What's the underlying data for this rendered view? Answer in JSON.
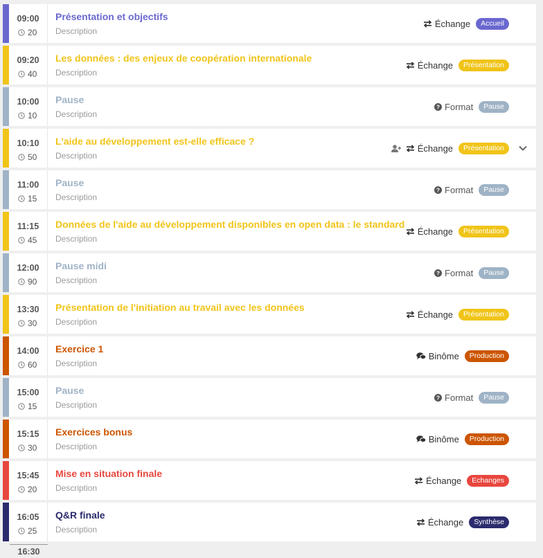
{
  "agenda": {
    "end_time": "16:30",
    "items": [
      {
        "time": "09:00",
        "duration": "20",
        "title": "Présentation et objectifs",
        "description": "Description",
        "exchange": "Échange",
        "exchange_icon": "arrows-exchange-icon",
        "badge": "Accueil",
        "color": "#6a68cf",
        "badge_color": "#6a68cf"
      },
      {
        "time": "09:20",
        "duration": "40",
        "title": "Les données : des enjeux de coopération internationale",
        "description": "Description",
        "exchange": "Échange",
        "exchange_icon": "arrows-exchange-icon",
        "badge": "Présentation",
        "color": "#f0c419",
        "badge_color": "#f0c419"
      },
      {
        "time": "10:00",
        "duration": "10",
        "title": "Pause",
        "description": "Description",
        "exchange": "Format",
        "exchange_icon": "question-circle-icon",
        "badge": "Pause",
        "color": "#9fb3c6",
        "badge_color": "#9fb3c6"
      },
      {
        "time": "10:10",
        "duration": "50",
        "title": "L'aide au développement est-elle efficace ?",
        "description": "Description",
        "exchange": "Échange",
        "exchange_icon": "arrows-exchange-icon",
        "badge": "Présentation",
        "color": "#f0c419",
        "badge_color": "#f0c419",
        "has_person_icon": true,
        "has_chevron": true
      },
      {
        "time": "11:00",
        "duration": "15",
        "title": "Pause",
        "description": "Description",
        "exchange": "Format",
        "exchange_icon": "question-circle-icon",
        "badge": "Pause",
        "color": "#9fb3c6",
        "badge_color": "#9fb3c6"
      },
      {
        "time": "11:15",
        "duration": "45",
        "title": "Données de l'aide au développement disponibles en open data : le standard",
        "description": "Description",
        "exchange": "Échange",
        "exchange_icon": "arrows-exchange-icon",
        "badge": "Présentation",
        "color": "#f0c419",
        "badge_color": "#f0c419"
      },
      {
        "time": "12:00",
        "duration": "90",
        "title": "Pause midi",
        "description": "Description",
        "exchange": "Format",
        "exchange_icon": "question-circle-icon",
        "badge": "Pause",
        "color": "#9fb3c6",
        "badge_color": "#9fb3c6"
      },
      {
        "time": "13:30",
        "duration": "30",
        "title": "Présentation de l'initiation au travail avec les données",
        "description": "Description",
        "exchange": "Échange",
        "exchange_icon": "arrows-exchange-icon",
        "badge": "Présentation",
        "color": "#f0c419",
        "badge_color": "#f0c419"
      },
      {
        "time": "14:00",
        "duration": "60",
        "title": "Exercice 1",
        "description": "Description",
        "exchange": "Binôme",
        "exchange_icon": "comments-icon",
        "badge": "Production",
        "color": "#cc5500",
        "badge_color": "#cc5500"
      },
      {
        "time": "15:00",
        "duration": "15",
        "title": "Pause",
        "description": "Description",
        "exchange": "Format",
        "exchange_icon": "question-circle-icon",
        "badge": "Pause",
        "color": "#9fb3c6",
        "badge_color": "#9fb3c6"
      },
      {
        "time": "15:15",
        "duration": "30",
        "title": "Exercices bonus",
        "description": "Description",
        "exchange": "Binôme",
        "exchange_icon": "comments-icon",
        "badge": "Production",
        "color": "#cc5500",
        "badge_color": "#cc5500"
      },
      {
        "time": "15:45",
        "duration": "20",
        "title": "Mise en situation finale",
        "description": "Description",
        "exchange": "Échange",
        "exchange_icon": "arrows-exchange-icon",
        "badge": "Echanges",
        "color": "#e8473e",
        "badge_color": "#e8473e"
      },
      {
        "time": "16:05",
        "duration": "25",
        "title": "Q&R finale",
        "description": "Description",
        "exchange": "Échange",
        "exchange_icon": "arrows-exchange-icon",
        "badge": "Synthèse",
        "color": "#2b2b6e",
        "badge_color": "#2b2b6e"
      }
    ]
  }
}
